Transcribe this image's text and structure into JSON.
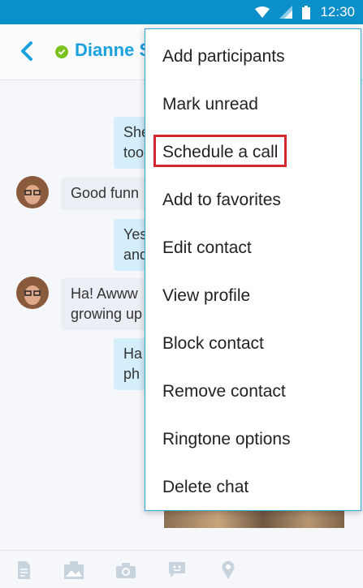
{
  "status_bar": {
    "time": "12:30",
    "icons": [
      "wifi-icon",
      "signal-icon",
      "battery-icon"
    ]
  },
  "header": {
    "contact_name": "Dianne S",
    "presence": "online"
  },
  "messages": [
    {
      "direction": "outgoing",
      "text": "She\ntoo"
    },
    {
      "direction": "incoming",
      "text": "Good funn"
    },
    {
      "direction": "outgoing",
      "text": "Yes\nand"
    },
    {
      "direction": "incoming",
      "text": "Ha! Awww\ngrowing up"
    },
    {
      "direction": "outgoing",
      "text": "Ha\nph"
    }
  ],
  "menu": {
    "items": [
      "Add participants",
      "Mark unread",
      "Schedule a call",
      "Add to favorites",
      "Edit contact",
      "View profile",
      "Block contact",
      "Remove contact",
      "Ringtone options",
      "Delete chat"
    ],
    "highlighted": "Schedule a call"
  },
  "toolbar": {
    "icons": [
      "file-icon",
      "image-icon",
      "camera-icon",
      "emoticon-icon",
      "location-icon"
    ]
  },
  "colors": {
    "accent": "#1aa1de",
    "status_bar": "#0a8fc9",
    "presence": "#7cc322",
    "highlight": "#d22630"
  }
}
